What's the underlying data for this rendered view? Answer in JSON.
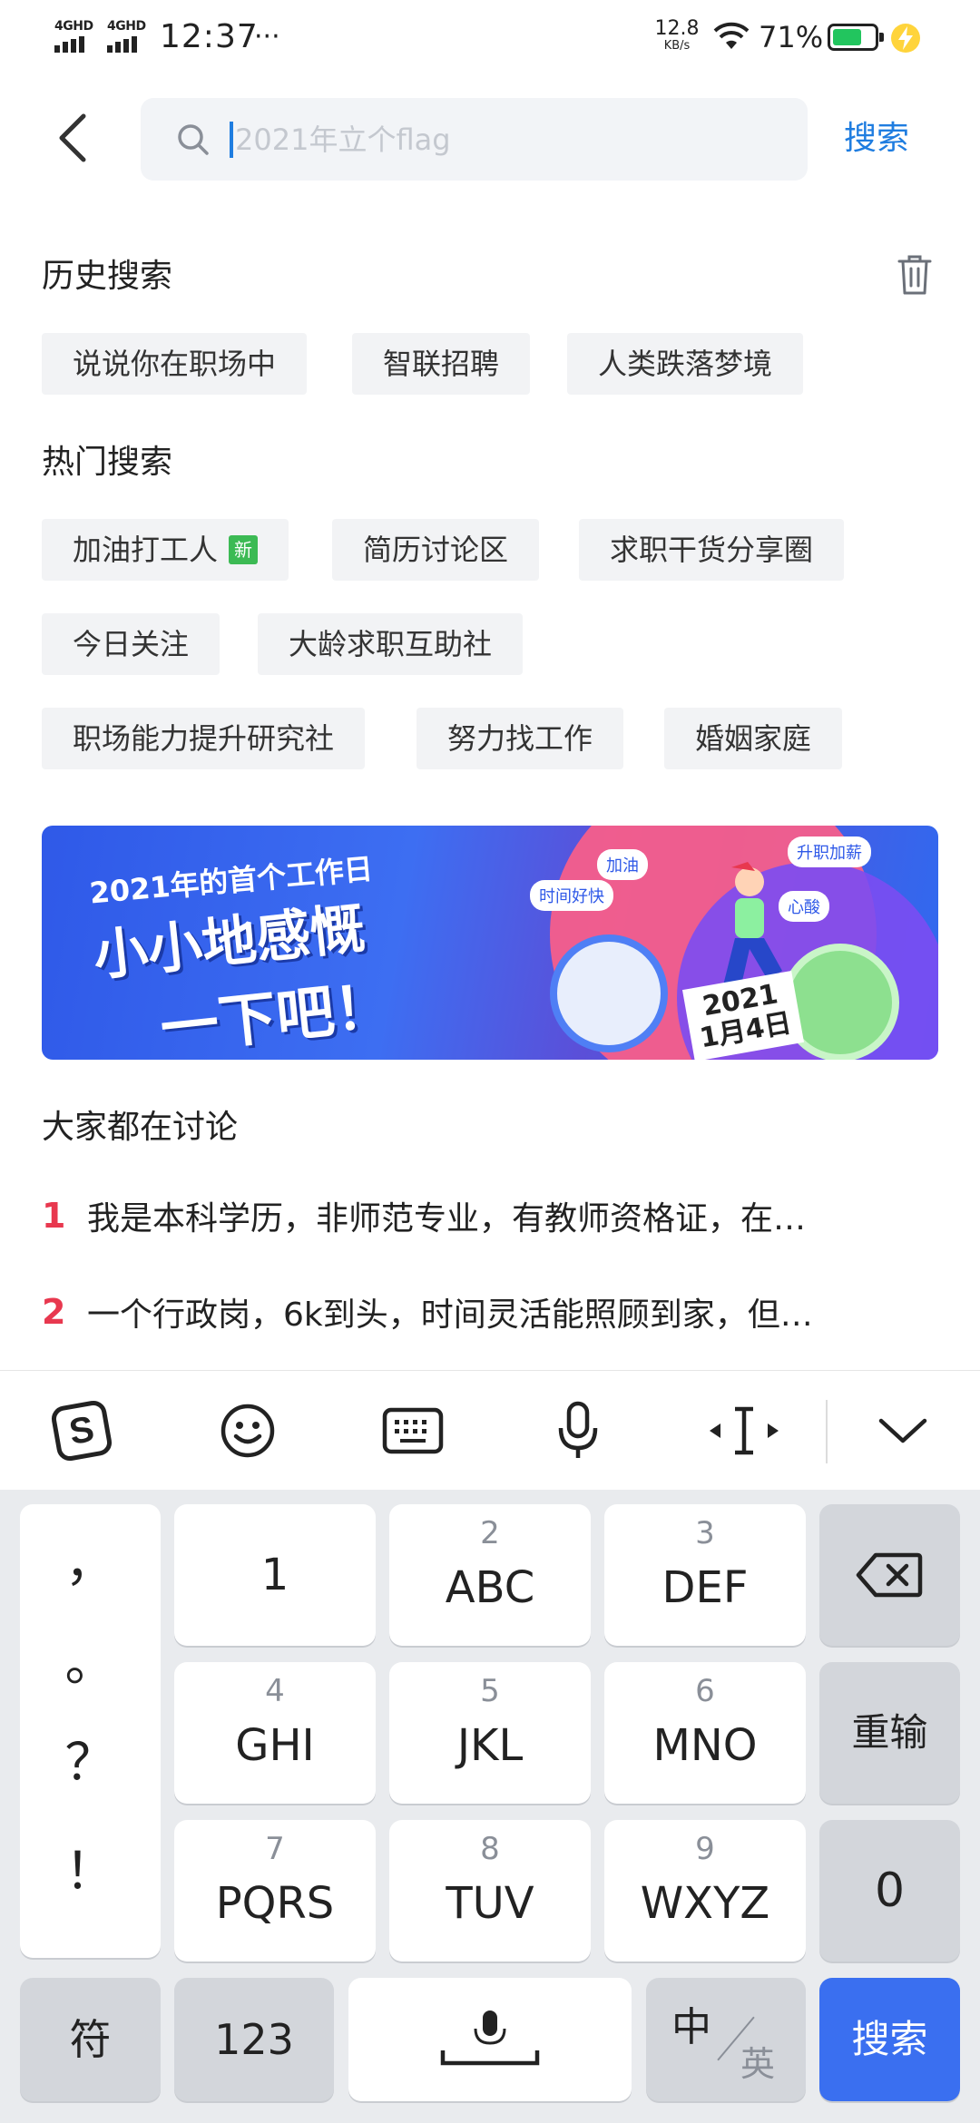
{
  "status_bar": {
    "signal1_label": "4GHD",
    "signal2_label": "4GHD",
    "time": "12:37",
    "more_dots": "···",
    "net_speed_value": "12.8",
    "net_speed_unit": "KB/s",
    "battery_percent": "71%",
    "battery_level": 0.71,
    "battery_color": "#22c55e"
  },
  "search": {
    "placeholder": "2021年立个flag",
    "value": "",
    "submit_label": "搜索",
    "accent_color": "#1f7de0"
  },
  "history": {
    "title": "历史搜索",
    "items": [
      "说说你在职场中",
      "智联招聘",
      "人类跌落梦境"
    ]
  },
  "hot": {
    "title": "热门搜索",
    "new_badge": "新",
    "items": [
      "加油打工人",
      "简历讨论区",
      "求职干货分享圈",
      "今日关注",
      "大龄求职互助社",
      "职场能力提升研究社",
      "努力找工作",
      "婚姻家庭"
    ]
  },
  "banner": {
    "line1": "2021年的首个工作日",
    "line2": "小小地感慨",
    "line3": "一下吧！",
    "bubbles": [
      "加油",
      "时间好快",
      "升职加薪",
      "心酸"
    ],
    "date_year": "2021",
    "date_day": "1月4日"
  },
  "discussion": {
    "title": "大家都在讨论",
    "items": [
      {
        "rank": "1",
        "text": "我是本科学历，非师范专业，有教师资格证，在…"
      },
      {
        "rank": "2",
        "text": "一个行政岗，6k到头，时间灵活能照顾到家，但…"
      }
    ]
  },
  "keyboard_toolbar": {
    "icons": [
      "sogou-logo-icon",
      "emoji-icon",
      "keyboard-icon",
      "microphone-icon",
      "cursor-move-icon",
      "collapse-chevron-icon"
    ]
  },
  "keyboard": {
    "punctuation": [
      "，",
      "。",
      "？",
      "！"
    ],
    "keys": [
      {
        "sub": "",
        "main": "1"
      },
      {
        "sub": "2",
        "main": "ABC"
      },
      {
        "sub": "3",
        "main": "DEF"
      },
      {
        "sub": "4",
        "main": "GHI"
      },
      {
        "sub": "5",
        "main": "JKL"
      },
      {
        "sub": "6",
        "main": "MNO"
      },
      {
        "sub": "7",
        "main": "PQRS"
      },
      {
        "sub": "8",
        "main": "TUV"
      },
      {
        "sub": "9",
        "main": "WXYZ"
      }
    ],
    "retype": "重输",
    "zero": "0",
    "symbols": "符",
    "numbers": "123",
    "lang_zh": "中",
    "lang_en": "英",
    "search": "搜索",
    "search_color": "#3a6ff0"
  }
}
